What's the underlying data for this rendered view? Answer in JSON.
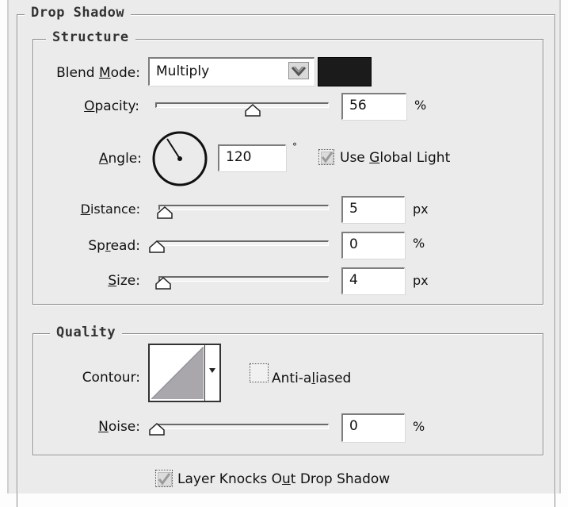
{
  "drop_shadow": {
    "title": "Drop Shadow"
  },
  "structure": {
    "title": "Structure",
    "blend_mode": {
      "label_pre": "Blend ",
      "label_u": "M",
      "label_post": "ode:",
      "value": "Multiply",
      "shadow_color": "#1b1b1b"
    },
    "opacity": {
      "label_pre": "",
      "label_u": "O",
      "label_post": "pacity:",
      "value": "56",
      "unit": "%",
      "level_percent": 56
    },
    "angle": {
      "label_pre": "",
      "label_u": "A",
      "label_post": "ngle:",
      "value": "120",
      "unit": "°",
      "degrees": 120
    },
    "use_global_light": {
      "label_pre": "Use ",
      "label_u": "G",
      "label_post": "lobal Light",
      "checked": true
    },
    "distance": {
      "label_pre": "",
      "label_u": "D",
      "label_post": "istance:",
      "value": "5",
      "unit": "px"
    },
    "spread": {
      "label_pre": "Sp",
      "label_u": "r",
      "label_post": "ead:",
      "value": "0",
      "unit": "%"
    },
    "size": {
      "label_pre": "",
      "label_u": "S",
      "label_post": "ize:",
      "value": "4",
      "unit": "px"
    }
  },
  "quality": {
    "title": "Quality",
    "contour": {
      "label": "Contour:"
    },
    "anti_aliased": {
      "label_pre": "Anti-a",
      "label_u": "l",
      "label_post": "iased",
      "checked": false
    },
    "noise": {
      "label_pre": "",
      "label_u": "N",
      "label_post": "oise:",
      "value": "0",
      "unit": "%"
    }
  },
  "layer_knocks_out": {
    "label_pre": "Layer Knocks O",
    "label_u": "u",
    "label_post": "t Drop Shadow",
    "checked": true
  }
}
